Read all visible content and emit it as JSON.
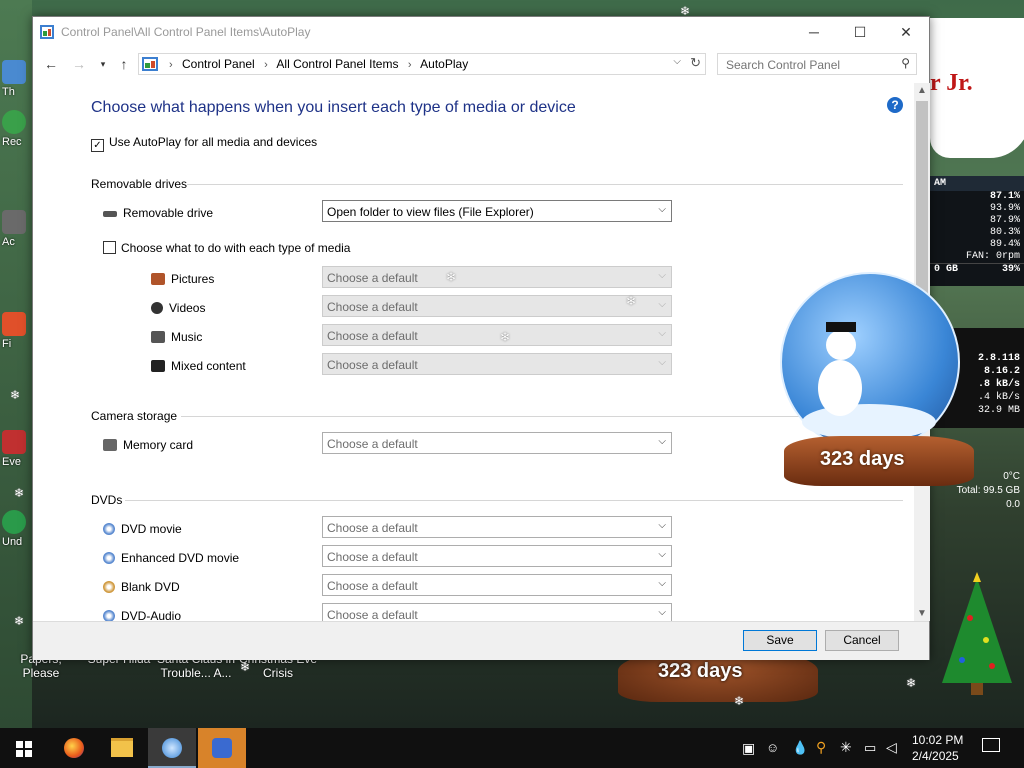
{
  "window": {
    "title": "Control Panel\\All Control Panel Items\\AutoPlay",
    "controls": {
      "minimize": "─",
      "maximize": "☐",
      "close": "✕"
    }
  },
  "address": {
    "crumbs": [
      "Control Panel",
      "All Control Panel Items",
      "AutoPlay"
    ],
    "search_placeholder": "Search Control Panel"
  },
  "page": {
    "heading": "Choose what happens when you insert each type of media or device",
    "use_autoplay_label": "Use AutoPlay for all media and devices",
    "use_autoplay_checked": true,
    "help_glyph": "?"
  },
  "removable": {
    "section": "Removable drives",
    "drive_label": "Removable drive",
    "drive_value": "Open folder to view files (File Explorer)",
    "choose_each_label": "Choose what to do with each type of media",
    "choose_each_checked": false,
    "media": [
      {
        "label": "Pictures",
        "value": "Choose a default"
      },
      {
        "label": "Videos",
        "value": "Choose a default"
      },
      {
        "label": "Music",
        "value": "Choose a default"
      },
      {
        "label": "Mixed content",
        "value": "Choose a default"
      }
    ]
  },
  "camera": {
    "section": "Camera storage",
    "items": [
      {
        "label": "Memory card",
        "value": "Choose a default"
      }
    ]
  },
  "dvds": {
    "section": "DVDs",
    "items": [
      {
        "label": "DVD movie",
        "value": "Choose a default"
      },
      {
        "label": "Enhanced DVD movie",
        "value": "Choose a default"
      },
      {
        "label": "Blank DVD",
        "value": "Choose a default"
      },
      {
        "label": "DVD-Audio",
        "value": "Choose a default"
      }
    ]
  },
  "footer": {
    "save": "Save",
    "cancel": "Cancel"
  },
  "desktop": {
    "speech_text": "r Jr.",
    "globe_days": "323 days",
    "globe2_days": "323 days",
    "gadget_header": "AM",
    "gadget_rows": [
      "87.1%",
      "93.9%",
      "87.9%",
      "80.3%",
      "89.4%",
      "FAN: 0rpm"
    ],
    "gadget_mem": [
      "0 GB",
      "39%"
    ],
    "net_rows": [
      "2.8.118",
      "8.16.2",
      ".8 kB/s",
      ".4 kB/s",
      "32.9 MB"
    ],
    "disk_rows": [
      "0°C",
      "Total: 99.5 GB",
      "0.0"
    ],
    "icon_labels": [
      "Th",
      "Rec",
      "Ac",
      "Fi",
      "Eve",
      "Und"
    ],
    "bottom_labels": [
      "Papers, Please",
      "Super Hiida",
      "Santa Claus in Trouble... A...",
      "Christmas Eve Crisis"
    ]
  },
  "taskbar": {
    "time": "10:02 PM",
    "date": "2/4/2025"
  },
  "colors": {
    "heading": "#1e3287",
    "accent": "#0078d7",
    "taskbar": "#101010"
  }
}
